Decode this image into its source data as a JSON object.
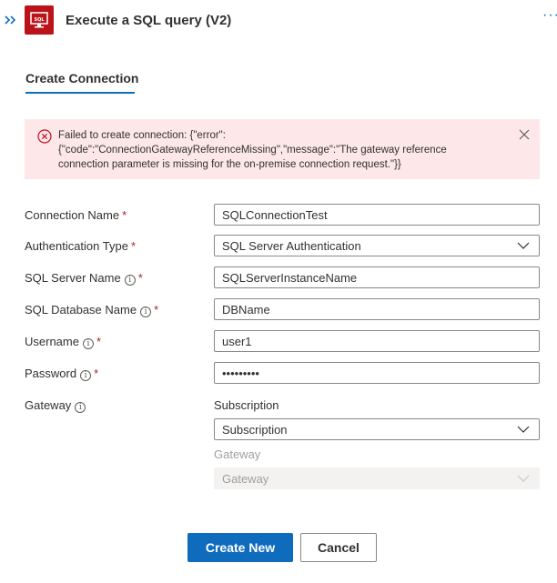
{
  "header": {
    "title": "Execute a SQL query (V2)",
    "expand_icon": "double-chevron-right-icon",
    "app_icon": "sql-server-icon",
    "more_label": "···",
    "brand_color": "#ba141a"
  },
  "tabs": [
    {
      "label": "Create Connection",
      "active": true
    }
  ],
  "error": {
    "line1": "Failed to create connection: {\"error\":",
    "line2": "{\"code\":\"ConnectionGatewayReferenceMissing\",\"message\":\"The gateway reference",
    "line3": "connection parameter is missing for the on-premise connection request.\"}}",
    "icon": "error-circle-icon",
    "close_icon": "close-icon"
  },
  "form": {
    "required_marker": "*",
    "info_glyph": "i",
    "connection_name": {
      "label": "Connection Name",
      "value": "SQLConnectionTest"
    },
    "authentication_type": {
      "label": "Authentication Type",
      "value": "SQL Server Authentication"
    },
    "sql_server_name": {
      "label": "SQL Server Name",
      "value": "SQLServerInstanceName"
    },
    "sql_database_name": {
      "label": "SQL Database Name",
      "value": "DBName"
    },
    "username": {
      "label": "Username",
      "value": "user1"
    },
    "password": {
      "label": "Password",
      "value": "•••••••••"
    },
    "gateway": {
      "label": "Gateway",
      "subscription_label": "Subscription",
      "subscription_value": "Subscription",
      "gateway_label": "Gateway",
      "gateway_value": "Gateway"
    }
  },
  "buttons": {
    "create_new": "Create New",
    "cancel": "Cancel"
  },
  "colors": {
    "accent": "#0f6cbd",
    "error_bg": "#fde7e9",
    "error_icon": "#c50f1f",
    "required": "#a4262c"
  }
}
